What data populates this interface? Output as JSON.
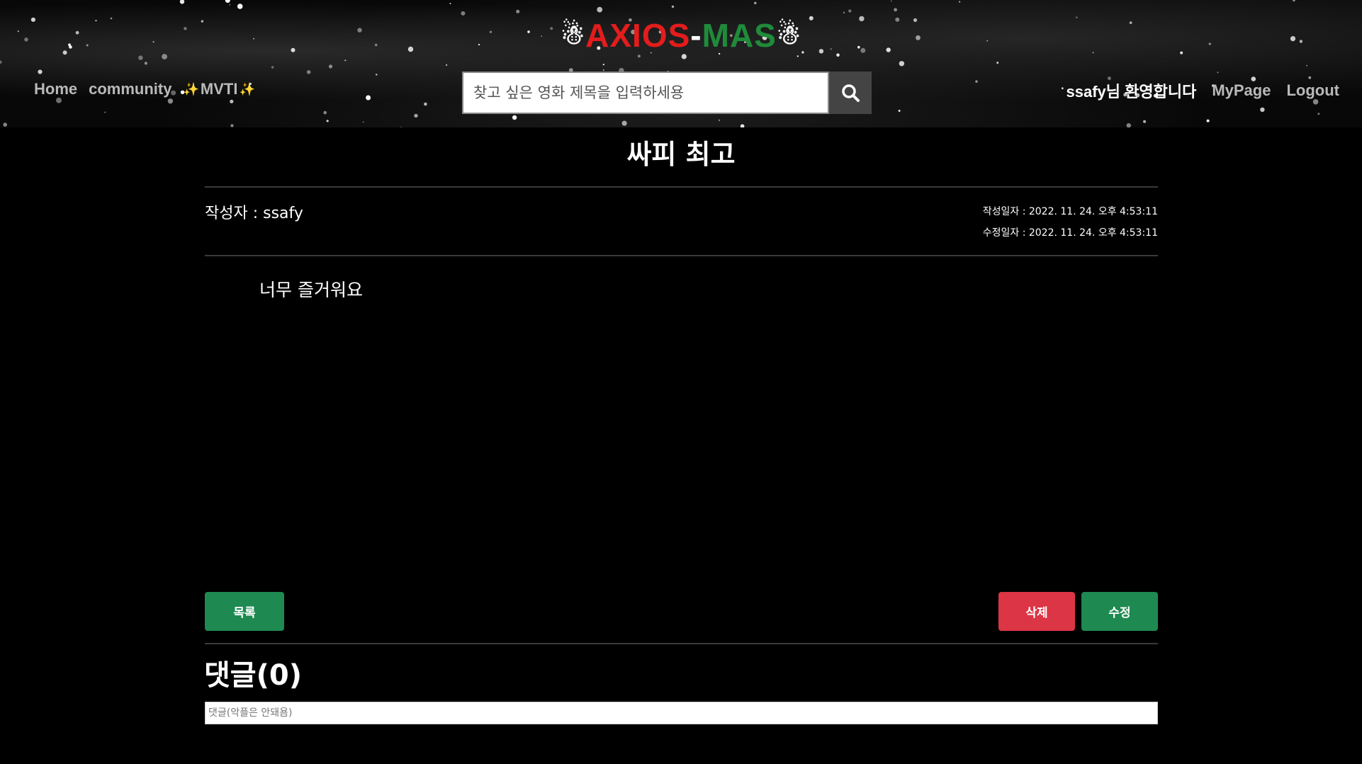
{
  "header": {
    "logo": {
      "part1": "AXIOS",
      "dash": "-",
      "part2": "MAS",
      "snowman": "☃"
    },
    "nav": {
      "home": "Home",
      "community": "community",
      "mvti": "MVTI",
      "sparkle": "✨"
    },
    "search": {
      "placeholder": "찾고 싶은 영화 제목을 입력하세용"
    },
    "user": {
      "welcome": "ssafy님 환영합니다",
      "mypage": "MyPage",
      "logout": "Logout"
    }
  },
  "post": {
    "title": "싸피 최고",
    "author": "작성자 : ssafy",
    "created": "작성일자 : 2022. 11. 24. 오후 4:53:11",
    "modified": "수정일자 : 2022. 11. 24. 오후 4:53:11",
    "content": "너무 즐거워요"
  },
  "buttons": {
    "list": "목록",
    "delete": "삭제",
    "edit": "수정"
  },
  "comments": {
    "title": "댓글(0)",
    "placeholder": "댓글(악플은 안돼욤)"
  },
  "colors": {
    "logo_red": "#e41c1c",
    "logo_green": "#1f8b3b",
    "button_green": "#1e8a51",
    "button_red": "#dc3545"
  },
  "icons": {
    "search": "search-icon",
    "logo_decoration": "snowman-icon",
    "mvti_decoration": "sparkle-icon"
  }
}
